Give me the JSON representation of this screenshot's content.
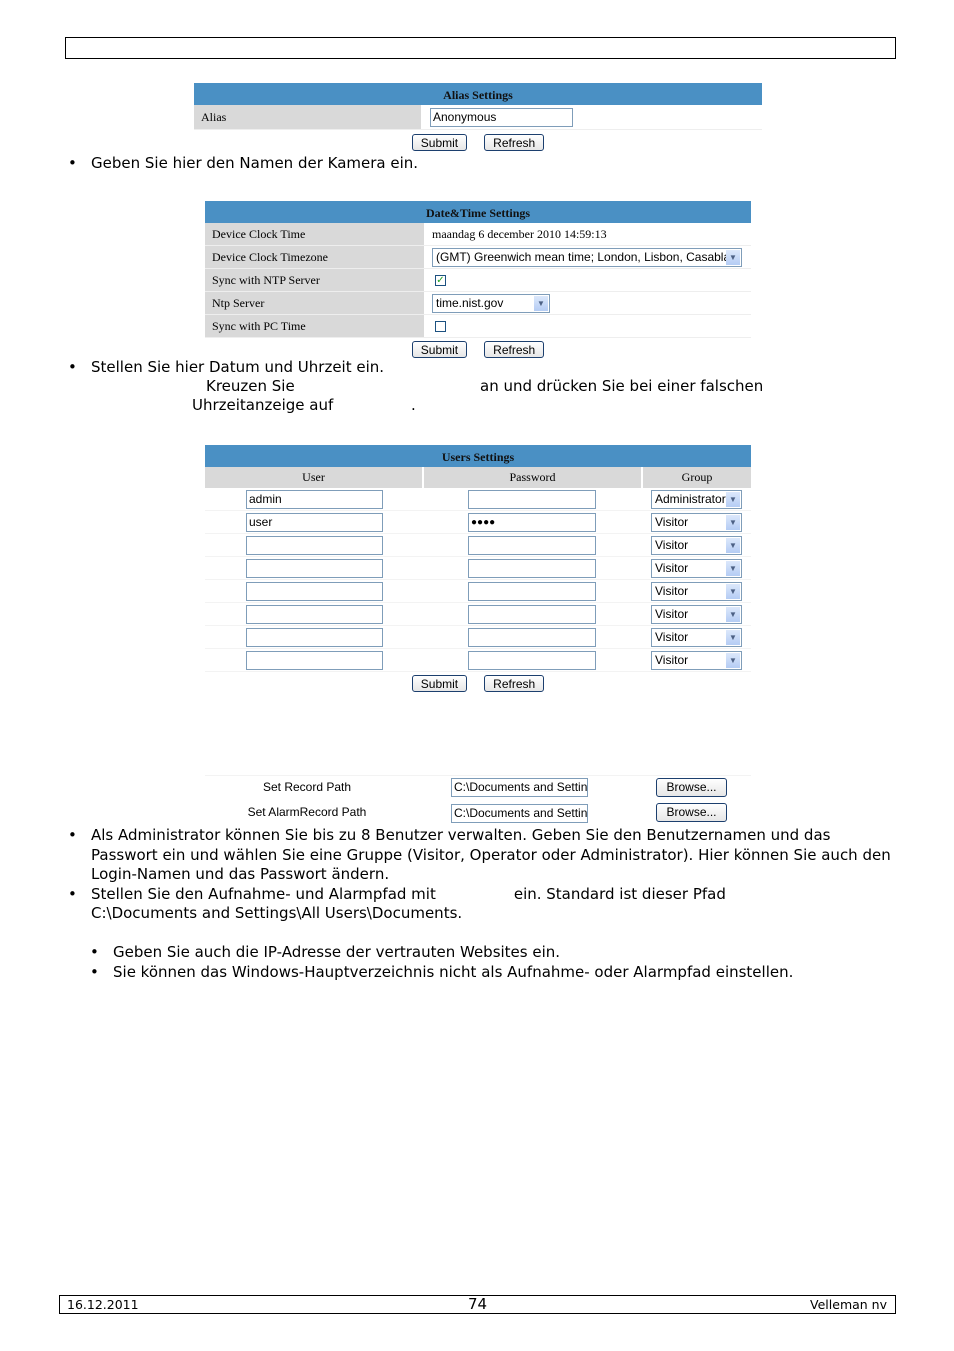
{
  "page": {
    "footer": {
      "date": "16.12.2011",
      "page_number": "74",
      "company": "Velleman nv"
    }
  },
  "alias_panel": {
    "title": "Alias Settings",
    "alias_label": "Alias",
    "alias_value": "Anonymous",
    "submit_label": "Submit",
    "refresh_label": "Refresh"
  },
  "alias_text": "Geben Sie hier den Namen der Kamera ein.",
  "datetime_panel": {
    "title": "Date&Time Settings",
    "rows": [
      {
        "label": "Device Clock Time",
        "value": "maandag 6 december 2010 14:59:13"
      },
      {
        "label": "Device Clock Timezone",
        "value": "(GMT) Greenwich mean time; London, Lisbon, Casablan"
      },
      {
        "label": "Sync with NTP Server",
        "checked": true
      },
      {
        "label": "Ntp Server",
        "value": "time.nist.gov"
      },
      {
        "label": "Sync with PC Time",
        "checked": false
      }
    ],
    "submit_label": "Submit",
    "refresh_label": "Refresh"
  },
  "datetime_text": {
    "line1": "Stellen Sie hier Datum und Uhrzeit ein.",
    "line2a": "Kreuzen Sie",
    "line2b": "an und drücken Sie bei einer falschen",
    "line3a": "Uhrzeitanzeige auf",
    "line3b": "."
  },
  "users_panel": {
    "title": "Users Settings",
    "columns": [
      "User",
      "Password",
      "Group"
    ],
    "rows": [
      {
        "user": "admin",
        "password": "",
        "group": "Administrator"
      },
      {
        "user": "user",
        "password": "●●●●",
        "group": "Visitor"
      },
      {
        "user": "",
        "password": "",
        "group": "Visitor"
      },
      {
        "user": "",
        "password": "",
        "group": "Visitor"
      },
      {
        "user": "",
        "password": "",
        "group": "Visitor"
      },
      {
        "user": "",
        "password": "",
        "group": "Visitor"
      },
      {
        "user": "",
        "password": "",
        "group": "Visitor"
      },
      {
        "user": "",
        "password": "",
        "group": "Visitor"
      }
    ],
    "submit_label": "Submit",
    "refresh_label": "Refresh"
  },
  "paths_panel": {
    "record_label": "Set Record Path",
    "record_value": "C:\\Documents and Setting",
    "alarm_label": "Set AlarmRecord Path",
    "alarm_value": "C:\\Documents and Setting",
    "browse_label": "Browse..."
  },
  "bottom_text": {
    "b1": "Als Administrator können Sie bis zu 8 Benutzer verwalten. Geben Sie den Benutzernamen und das Passwort ein und wählen Sie eine Gruppe (Visitor, Operator oder Administrator). Hier können Sie auch den Login-Namen und das Passwort ändern.",
    "b2a": "Stellen Sie den Aufnahme- und Alarmpfad mit",
    "b2b": "ein. Standard ist dieser Pfad",
    "b2c": "C:\\Documents and Settings\\All Users\\Documents.",
    "n1": "Geben Sie auch die IP-Adresse der vertrauten Websites ein.",
    "n2": "Sie können das Windows-Hauptverzeichnis nicht als Aufnahme- oder Alarmpfad einstellen."
  }
}
